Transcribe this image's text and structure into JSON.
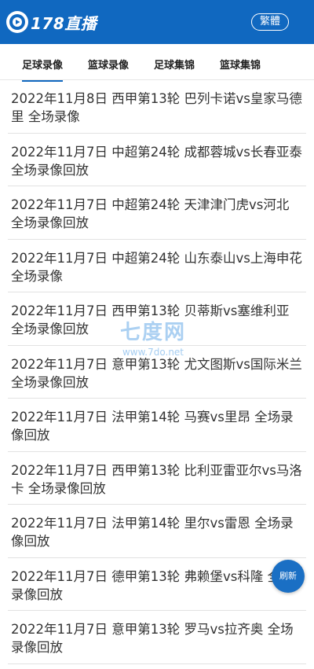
{
  "header": {
    "logo_text": "178直播",
    "traditional_button": "繁體"
  },
  "tabs": [
    {
      "label": "足球录像"
    },
    {
      "label": "篮球录像"
    },
    {
      "label": "足球集锦"
    },
    {
      "label": "篮球集锦"
    }
  ],
  "items": [
    {
      "text": "2022年11月8日 西甲第13轮 巴列卡诺vs皇家马德里 全场录像"
    },
    {
      "text": "2022年11月7日 中超第24轮 成都蓉城vs长春亚泰 全场录像回放"
    },
    {
      "text": "2022年11月7日 中超第24轮 天津津门虎vs河北 全场录像回放"
    },
    {
      "text": "2022年11月7日 中超第24轮 山东泰山vs上海申花 全场录像"
    },
    {
      "text": "2022年11月7日 西甲第13轮 贝蒂斯vs塞维利亚 全场录像回放"
    },
    {
      "text": "2022年11月7日 意甲第13轮 尤文图斯vs国际米兰 全场录像回放"
    },
    {
      "text": "2022年11月7日 法甲第14轮 马赛vs里昂 全场录像回放"
    },
    {
      "text": "2022年11月7日 西甲第13轮 比利亚雷亚尔vs马洛卡 全场录像回放"
    },
    {
      "text": "2022年11月7日 法甲第14轮 里尔vs雷恩 全场录像回放"
    },
    {
      "text": "2022年11月7日 德甲第13轮 弗赖堡vs科隆 全场录像回放"
    },
    {
      "text": "2022年11月7日 意甲第13轮 罗马vs拉齐奥 全场录像回放"
    }
  ],
  "watermark": {
    "main": "七度网",
    "sub": "www.7do.net"
  },
  "refresh_button": "刷新",
  "colors": {
    "brand": "#1068c0",
    "text": "#333333",
    "divider": "#e2e2e2"
  }
}
